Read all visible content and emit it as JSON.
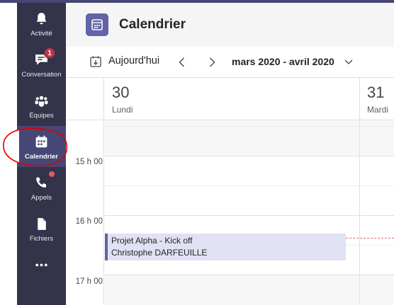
{
  "rail": {
    "items": [
      {
        "label": "Activité",
        "icon": "bell-icon"
      },
      {
        "label": "Conversation",
        "icon": "chat-icon",
        "badge": "1"
      },
      {
        "label": "Équipes",
        "icon": "teams-icon"
      },
      {
        "label": "Calendrier",
        "icon": "calendar-icon",
        "active": true
      },
      {
        "label": "Appels",
        "icon": "phone-icon",
        "dot": true
      },
      {
        "label": "Fichiers",
        "icon": "file-icon"
      },
      {
        "label": "",
        "icon": "more-icon"
      }
    ]
  },
  "header": {
    "title": "Calendrier"
  },
  "toolbar": {
    "today_label": "Aujourd'hui",
    "range_label": "mars 2020 - avril 2020"
  },
  "days": [
    {
      "number": "30",
      "name": "Lundi"
    },
    {
      "number": "31",
      "name": "Mardi"
    }
  ],
  "hours": [
    "15 h 00",
    "16 h 00",
    "17 h 00"
  ],
  "event": {
    "title": "Projet Alpha - Kick off",
    "organizer": "Christophe DARFEUILLE"
  },
  "colors": {
    "rail_bg": "#33344a",
    "accent": "#6264a7",
    "event_bg": "#e0e1f3",
    "badge": "#c4314b",
    "annotation": "#e00000"
  }
}
